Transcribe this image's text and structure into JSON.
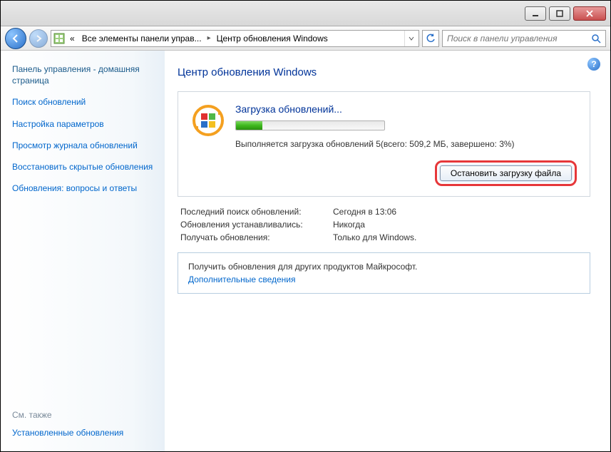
{
  "nav": {
    "breadcrumb1_prefix": "«",
    "breadcrumb1": "Все элементы панели управ...",
    "breadcrumb2": "Центр обновления Windows"
  },
  "search": {
    "placeholder": "Поиск в панели управления"
  },
  "sidebar": {
    "home": "Панель управления - домашняя страница",
    "links": [
      "Поиск обновлений",
      "Настройка параметров",
      "Просмотр журнала обновлений",
      "Восстановить скрытые обновления",
      "Обновления: вопросы и ответы"
    ],
    "see_also_label": "См. также",
    "see_also_link": "Установленные обновления"
  },
  "main": {
    "title": "Центр обновления Windows",
    "download_title": "Загрузка обновлений...",
    "download_status": "Выполняется загрузка обновлений 5(всего: 509,2 МБ, завершено: 3%)",
    "progress_percent": 18,
    "stop_button": "Остановить загрузку файла",
    "info": {
      "last_search_label": "Последний поиск обновлений:",
      "last_search_value": "Сегодня в 13:06",
      "installed_label": "Обновления устанавливались:",
      "installed_value": "Никогда",
      "receive_label": "Получать обновления:",
      "receive_value": "Только для Windows."
    },
    "box": {
      "text": "Получить обновления для других продуктов Майкрософт.",
      "link": "Дополнительные сведения"
    }
  }
}
